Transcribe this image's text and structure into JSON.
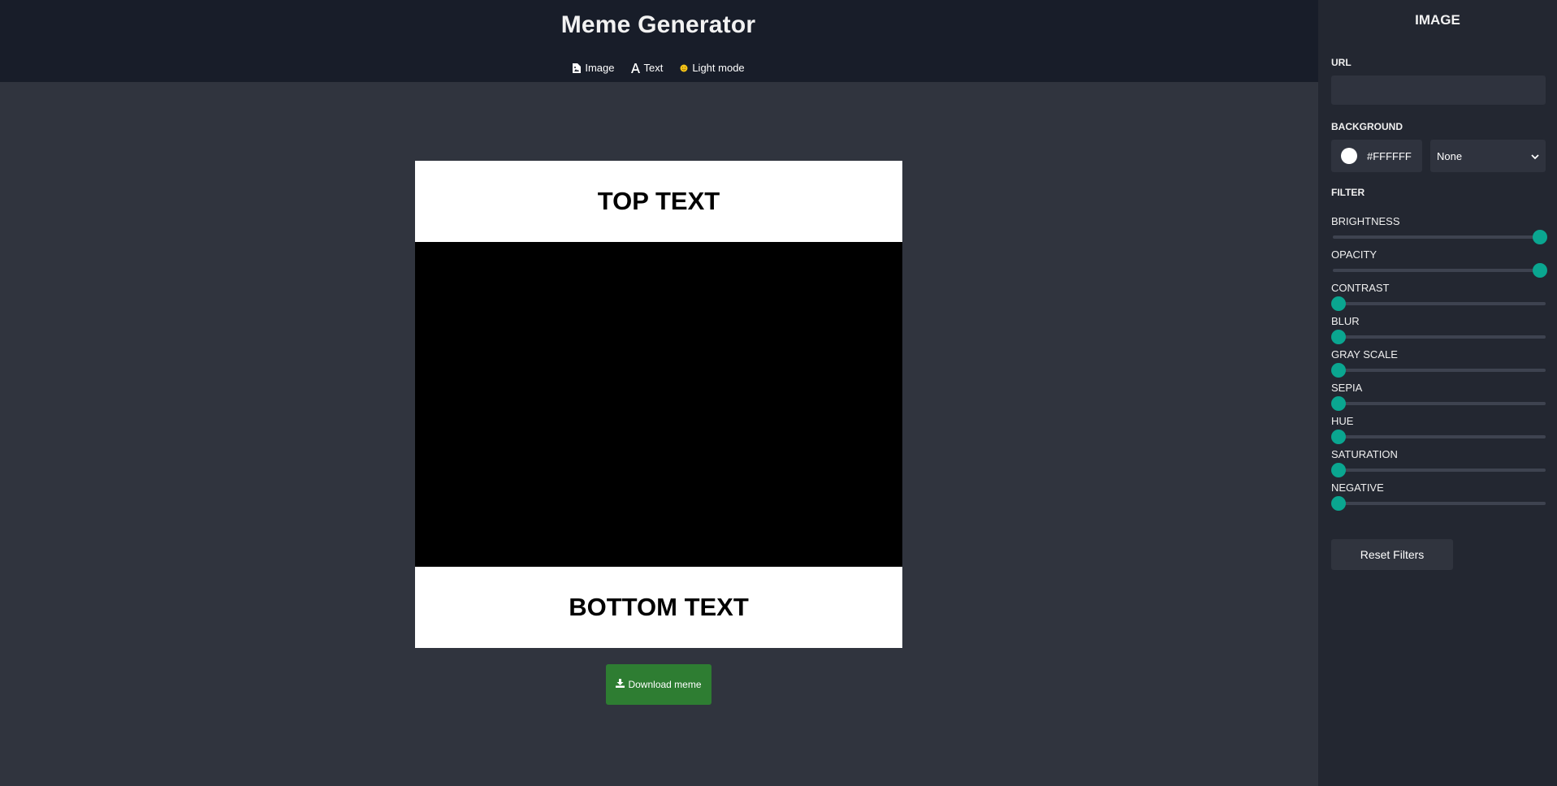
{
  "header": {
    "title": "Meme Generator",
    "nav": [
      {
        "label": "Image",
        "icon": "file-image-icon"
      },
      {
        "label": "Text",
        "icon": "font-icon"
      },
      {
        "label": "Light mode",
        "icon": "sun-icon"
      }
    ]
  },
  "meme": {
    "top_text": "TOP TEXT",
    "bottom_text": "BOTTOM TEXT",
    "download_label": "Download meme"
  },
  "panel": {
    "title": "IMAGE",
    "url_label": "URL",
    "url_value": "",
    "background_label": "BACKGROUND",
    "background_color": "#FFFFFF",
    "blend_mode": "None",
    "filter_label": "FILTER",
    "filters": [
      {
        "label": "BRIGHTNESS",
        "level": 1
      },
      {
        "label": "OPACITY",
        "level": 1
      },
      {
        "label": "CONTRAST",
        "level": 0
      },
      {
        "label": "BLUR",
        "level": 0
      },
      {
        "label": "GRAY SCALE",
        "level": 0
      },
      {
        "label": "SEPIA",
        "level": 0
      },
      {
        "label": "HUE",
        "level": 0
      },
      {
        "label": "SATURATION",
        "level": 0
      },
      {
        "label": "NEGATIVE",
        "level": 0
      }
    ],
    "reset_label": "Reset Filters"
  },
  "colors": {
    "accent": "#0aa690",
    "download": "#2e7d32",
    "sun": "#f5c518"
  }
}
